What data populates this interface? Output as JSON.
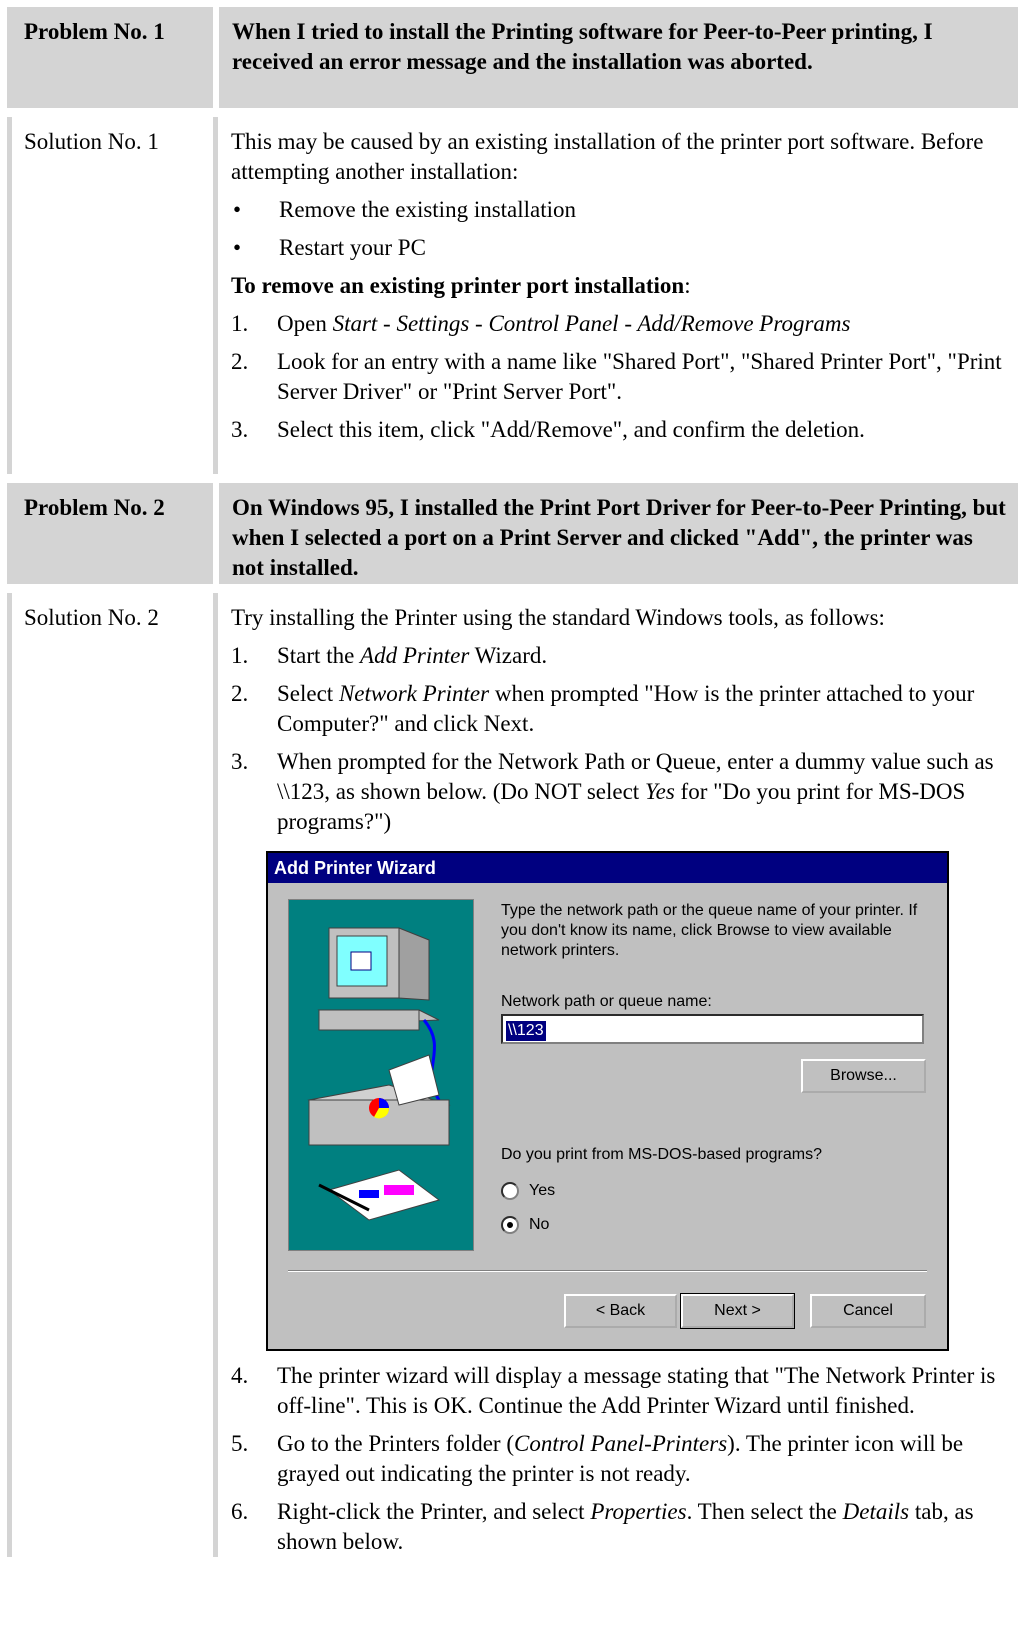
{
  "problem1": {
    "label": "Problem No. 1",
    "text": "When I tried to install the Printing software for Peer-to-Peer printing, I received an error message and the installation was aborted."
  },
  "solution1": {
    "label": "Solution No. 1",
    "intro": "This may be caused by an existing installation of the printer port software. Before attempting another installation:",
    "bullets": [
      "Remove the existing installation",
      "Restart your PC"
    ],
    "heading": "To remove an existing printer port installation",
    "heading_suffix": ":",
    "steps": [
      {
        "num": "1.",
        "pre": "Open ",
        "italic": "Start - Settings - Control Panel - Add/Remove Programs",
        "post": ""
      },
      {
        "num": "2.",
        "pre": "Look for an entry with a name like \"Shared Port\", \"Shared Printer Port\", \"Print Server Driver\" or \"Print Server Port\".",
        "italic": "",
        "post": ""
      },
      {
        "num": "3.",
        "pre": "Select this item, click \"Add/Remove\", and confirm the deletion.",
        "italic": "",
        "post": ""
      }
    ]
  },
  "problem2": {
    "label": "Problem No. 2",
    "text": "On Windows 95, I installed the Print Port Driver for Peer-to-Peer Printing, but when I selected a port on a Print Server and clicked \"Add\", the printer was not installed."
  },
  "solution2": {
    "label": "Solution No. 2",
    "intro": "Try installing the Printer using the standard Windows tools, as follows:",
    "step1": {
      "num": "1.",
      "pre": "Start the ",
      "italic": "Add Printer",
      "post": " Wizard."
    },
    "step2": {
      "num": "2.",
      "pre": "Select ",
      "italic": "Network Printer",
      "post": " when prompted \"How is the printer attached to your Computer?\" and click Next."
    },
    "step3": {
      "num": "3.",
      "pre": "When prompted for the Network Path or Queue, enter a dummy value such as \\\\123, as shown below. (Do NOT select ",
      "italic": "Yes",
      "post": " for \"Do you print for MS-DOS programs?\")"
    },
    "step4": {
      "num": "4.",
      "text": "The printer wizard will display a message stating that \"The Network Printer is off-line\". This is OK. Continue the Add Printer Wizard until finished."
    },
    "step5": {
      "num": "5.",
      "pre": "Go to the Printers folder (",
      "italic": "Control Panel-Printers",
      "post": "). The printer icon will be grayed out indicating the printer is not ready."
    },
    "step6": {
      "num": "6.",
      "pre": "Right-click the Printer, and select ",
      "italic": "Properties",
      "mid": ". Then select the ",
      "italic2": "Details",
      "post": " tab, as shown below."
    }
  },
  "dialog": {
    "title": "Add Printer Wizard",
    "description": "Type the network path or the queue name of your printer. If you don't know its name, click Browse to view available network printers.",
    "path_label": "Network path or queue name:",
    "path_value": "\\\\123",
    "browse": "Browse...",
    "question": "Do you print from MS-DOS-based programs?",
    "yes": "Yes",
    "no": "No",
    "back": "< Back",
    "next": "Next >",
    "cancel": "Cancel"
  }
}
